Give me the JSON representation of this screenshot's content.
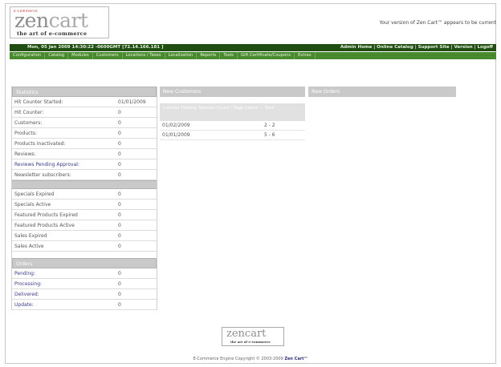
{
  "header": {
    "logo_tag": "e-commerce",
    "logo_zen": "zen",
    "logo_cart": "cart",
    "logo_sub": "the art of e-commerce",
    "version_note": "Your version of Zen Cart™ appears to be current"
  },
  "top_bar": {
    "session": "Mon, 05 Jan 2009 14:30:22 -0600GMT [72.14.166.181 ]",
    "links": "Admin Home | Online Catalog | Support Site | Version | Logoff"
  },
  "menu": [
    "Configuration",
    "Catalog",
    "Modules",
    "Customers",
    "Locations / Taxes",
    "Localization",
    "Reports",
    "Tools",
    "Gift Certificate/Coupons",
    "Extras"
  ],
  "stats": {
    "head": "Statistics",
    "rows": [
      {
        "k": "Hit Counter Started:",
        "v": "01/01/2009"
      },
      {
        "k": "Hit Counter:",
        "v": "0"
      },
      {
        "k": "Customers:",
        "v": "0"
      },
      {
        "k": "Products:",
        "v": "0"
      },
      {
        "k": "Products Inactivated:",
        "v": "0"
      },
      {
        "k": "Reviews:",
        "v": "0"
      },
      {
        "k": "Reviews Pending Approval:",
        "v": "0"
      },
      {
        "k": "Newsletter subscribers:",
        "v": "0"
      }
    ]
  },
  "specials": {
    "rows": [
      {
        "k": "Specials Expired",
        "v": "0"
      },
      {
        "k": "Specials Active",
        "v": "0"
      },
      {
        "k": "Featured Products Expired",
        "v": "0"
      },
      {
        "k": "Featured Products Active",
        "v": "0"
      },
      {
        "k": "Sales Expired",
        "v": "0"
      },
      {
        "k": "Sales Active",
        "v": "0"
      }
    ]
  },
  "orders": {
    "head": "Orders",
    "rows": [
      {
        "k": "Pending:",
        "v": "0"
      },
      {
        "k": "Processing:",
        "v": "0"
      },
      {
        "k": "Delivered:",
        "v": "0"
      },
      {
        "k": "Update:",
        "v": "0"
      }
    ]
  },
  "customers": {
    "head": "New Customers",
    "sub": "Counter History: Session Count / Page Count — Total",
    "rows": [
      {
        "d": "01/02/2009",
        "c": "2 - 2"
      },
      {
        "d": "01/01/2009",
        "c": "5 - 6"
      }
    ]
  },
  "new_orders": {
    "head": "New Orders"
  },
  "footer": {
    "logo_zen": "zencart",
    "logo_sub": "the art of e-commerce",
    "text": "E-Commerce Engine Copyright © 2003-2009",
    "brand": "Zen Cart™"
  }
}
